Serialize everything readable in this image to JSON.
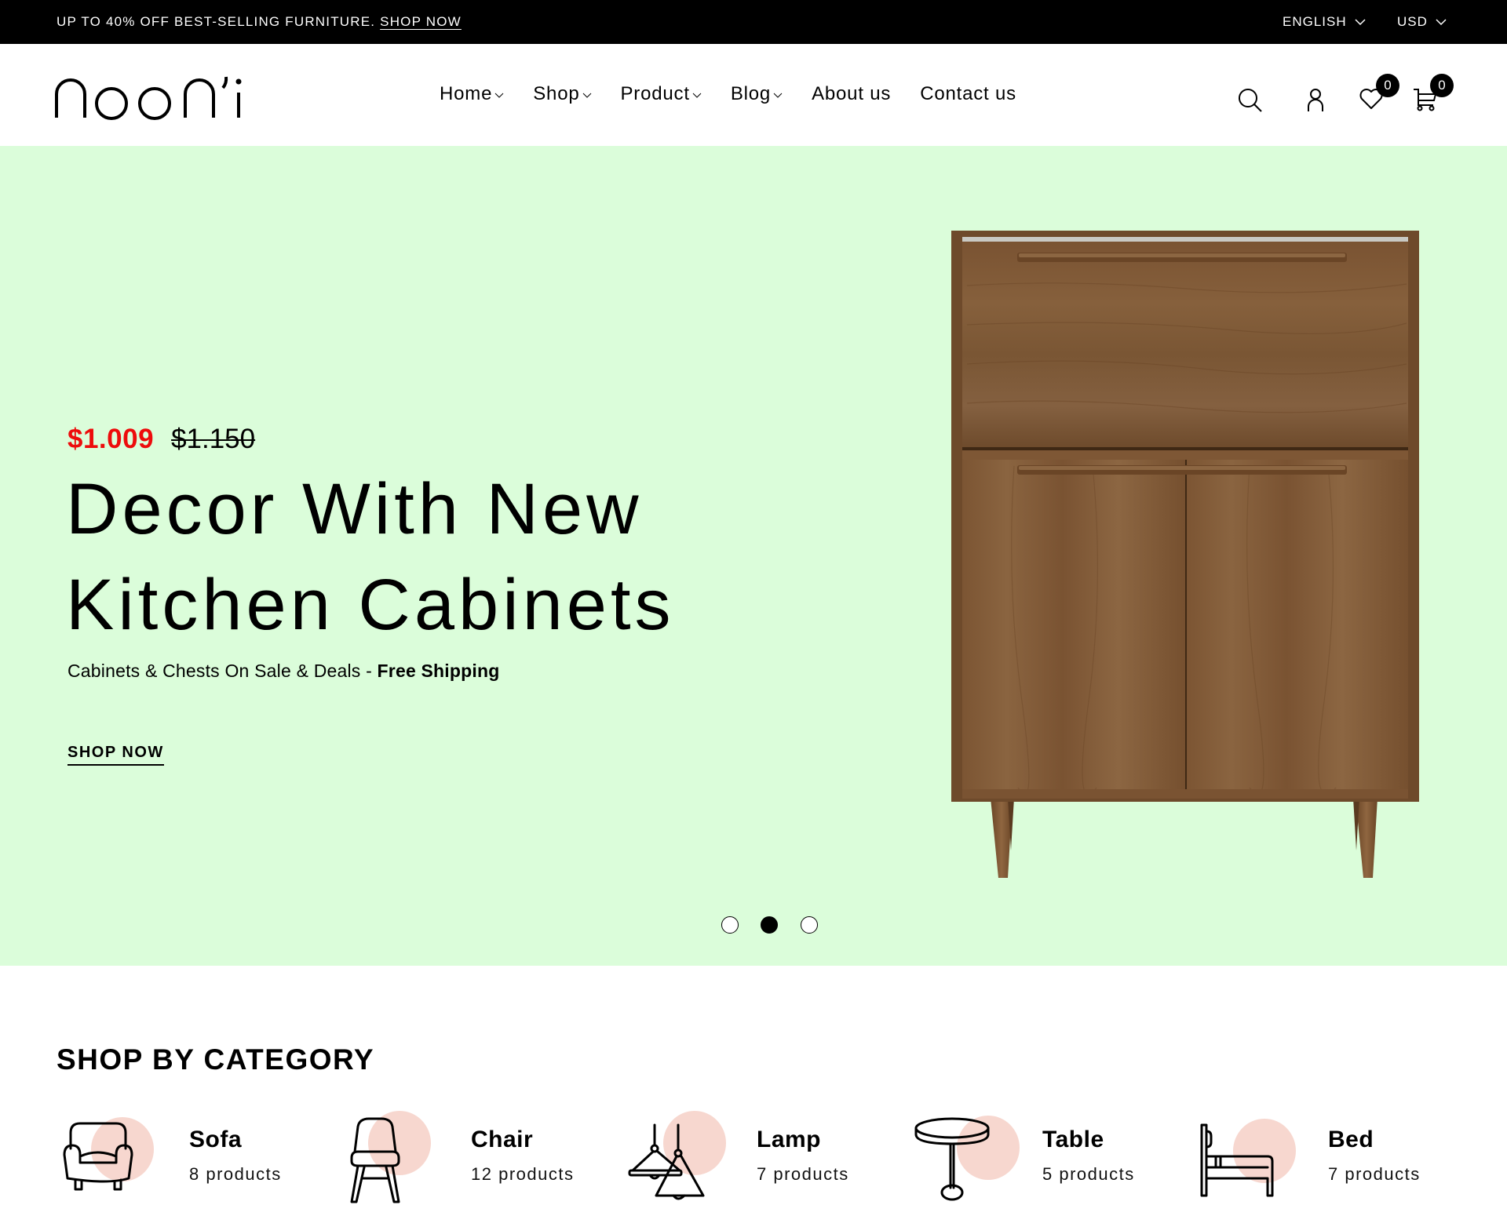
{
  "announcement": {
    "text": "UP TO 40% OFF BEST-SELLING FURNITURE.",
    "link_label": "SHOP NOW",
    "language": "ENGLISH",
    "currency": "USD"
  },
  "header": {
    "logo_text": "noon'i",
    "nav": [
      {
        "label": "Home",
        "has_dropdown": true
      },
      {
        "label": "Shop",
        "has_dropdown": true
      },
      {
        "label": "Product",
        "has_dropdown": true
      },
      {
        "label": "Blog",
        "has_dropdown": true
      },
      {
        "label": "About us",
        "has_dropdown": false
      },
      {
        "label": "Contact us",
        "has_dropdown": false
      }
    ],
    "icons": [
      "search-icon",
      "account-icon",
      "wishlist-icon",
      "cart-icon"
    ],
    "wishlist_count": "0",
    "cart_count": "0"
  },
  "hero": {
    "price_now": "$1.009",
    "price_old": "$1.150",
    "title_line1": "Decor With New",
    "title_line2": "Kitchen Cabinets",
    "subtitle": "Cabinets & Chests On Sale & Deals - ",
    "subtitle_bold": "Free Shipping",
    "cta_label": "SHOP NOW",
    "slides_total": 3,
    "active_slide": 2,
    "background_color": "#dbfdda",
    "price_color": "#ed0c0c"
  },
  "categories": {
    "title": "SHOP BY CATEGORY",
    "items": [
      {
        "name": "Sofa",
        "count": "8 products",
        "icon": "sofa-icon"
      },
      {
        "name": "Chair",
        "count": "12 products",
        "icon": "chair-icon"
      },
      {
        "name": "Lamp",
        "count": "7 products",
        "icon": "lamp-icon"
      },
      {
        "name": "Table",
        "count": "5 products",
        "icon": "table-icon"
      },
      {
        "name": "Bed",
        "count": "7 products",
        "icon": "bed-icon"
      }
    ],
    "accent_color": "#f7d7cf"
  }
}
